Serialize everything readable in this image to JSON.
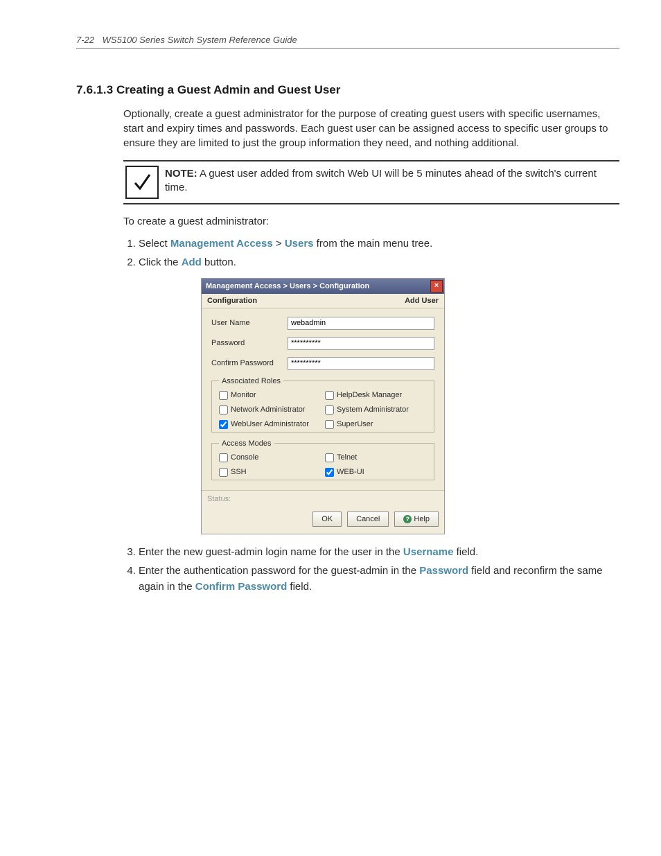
{
  "header": {
    "page_number": "7-22",
    "doc_title": "WS5100 Series Switch System Reference Guide"
  },
  "section": {
    "number": "7.6.1.3",
    "title": "Creating a Guest Admin and Guest User",
    "intro": "Optionally, create a guest administrator for the purpose of creating guest users with specific usernames, start and expiry times and passwords. Each guest user can be assigned access to specific user groups to ensure they are limited to just the group information they need, and nothing additional."
  },
  "note": {
    "label": "NOTE:",
    "text": " A guest user added from switch Web UI will be 5 minutes ahead of the switch's current time."
  },
  "lead_in": "To create a guest administrator:",
  "steps": {
    "s1_pre": "Select ",
    "s1_kw1": "Management Access",
    "s1_gt": " > ",
    "s1_kw2": "Users",
    "s1_post": " from the main menu tree.",
    "s2_pre": "Click the ",
    "s2_kw": "Add",
    "s2_post": " button.",
    "s3_pre": "Enter the new guest-admin login name for the user in the ",
    "s3_kw": "Username",
    "s3_post": " field.",
    "s4_pre": "Enter the authentication password for the guest-admin in the ",
    "s4_kw1": "Password",
    "s4_mid": " field and reconfirm the same again in the ",
    "s4_kw2": "Confirm Password",
    "s4_post": " field."
  },
  "dialog": {
    "breadcrumb": "Management Access > Users > Configuration",
    "sub_left": "Configuration",
    "sub_right": "Add User",
    "labels": {
      "username": "User Name",
      "password": "Password",
      "confirm": "Confirm Password",
      "roles_legend": "Associated Roles",
      "access_legend": "Access Modes",
      "status": "Status:"
    },
    "values": {
      "username": "webadmin",
      "password": "**********",
      "confirm": "**********"
    },
    "roles": {
      "monitor": "Monitor",
      "helpdesk": "HelpDesk Manager",
      "netadmin": "Network Administrator",
      "sysadmin": "System Administrator",
      "webuser": "WebUser Administrator",
      "superuser": "SuperUser"
    },
    "access": {
      "console": "Console",
      "telnet": "Telnet",
      "ssh": "SSH",
      "webui": "WEB-UI"
    },
    "buttons": {
      "ok": "OK",
      "cancel": "Cancel",
      "help": "Help"
    }
  }
}
